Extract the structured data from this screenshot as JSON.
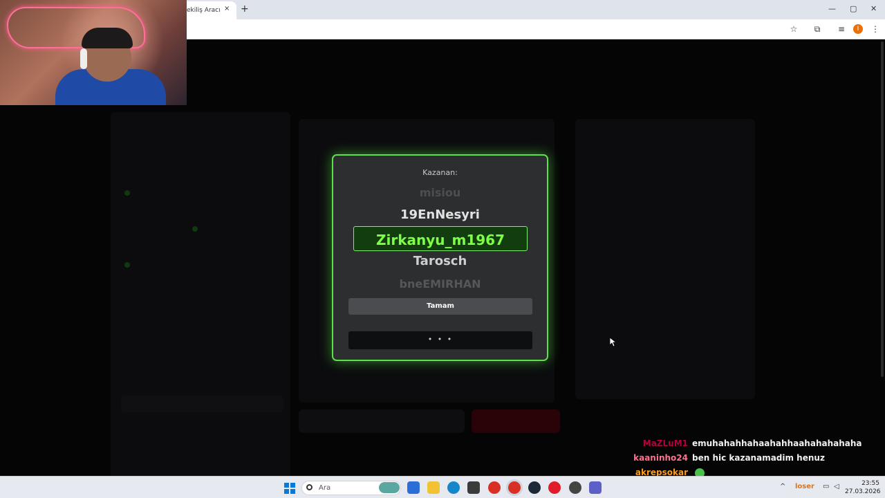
{
  "browser": {
    "tab_title": "ekiliş Aracı",
    "tab_close": "×",
    "new_tab": "+",
    "window_controls": [
      "—",
      "▢",
      "✕"
    ],
    "profile_initial": "I"
  },
  "modal": {
    "label": "Kazanan:",
    "names_before": [
      "misiou",
      "19EnNesyri"
    ],
    "winner": "Zirkanyu_m1967",
    "names_after": [
      "Tarosch",
      "bneEMIRHAN"
    ],
    "ok_button": "Tamam",
    "loading_dots": "• • •"
  },
  "chat": [
    {
      "user": "MaZLuM1",
      "color": "#b5003a",
      "message": "emuhahahhahaahahhaahahahahaha"
    },
    {
      "user": "kaaninho24",
      "color": "#ff6f8e",
      "message": "ben hic kazanamadim henuz"
    },
    {
      "user": "akrepsokar",
      "color": "#ff9b1a",
      "message": ""
    }
  ],
  "taskbar": {
    "search_placeholder": "Ara",
    "overlay_text": "loser",
    "time": "23:55",
    "date": "27.03.2026"
  }
}
